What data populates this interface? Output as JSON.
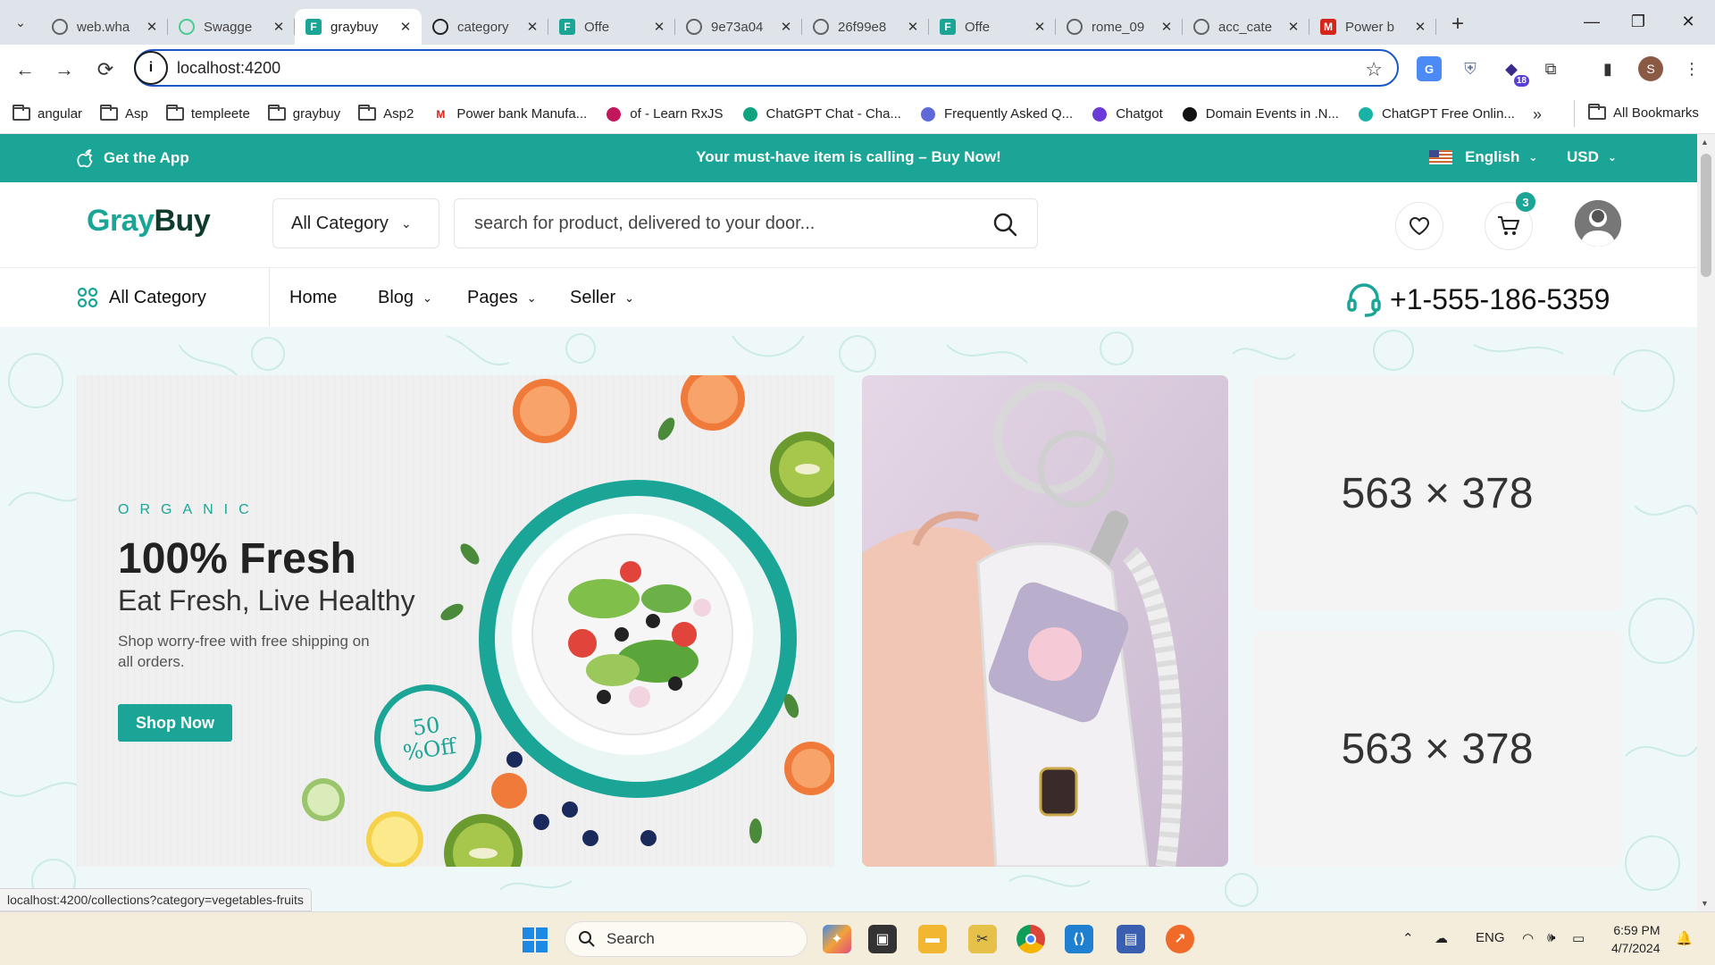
{
  "browser": {
    "tabs": [
      {
        "title": "web.wha",
        "favicon": "globe-icon",
        "color": "#5f6368"
      },
      {
        "title": "Swagge",
        "favicon": "swagger-icon",
        "color": "#49cc90"
      },
      {
        "title": "graybuy",
        "favicon": "F",
        "color": "#1aa596",
        "active": true
      },
      {
        "title": "category",
        "favicon": "angular-icon",
        "color": "#222222"
      },
      {
        "title": "Offe",
        "favicon": "F",
        "color": "#1aa596"
      },
      {
        "title": "9e73a04",
        "favicon": "globe-icon",
        "color": "#5f6368"
      },
      {
        "title": "26f99e8",
        "favicon": "globe-icon",
        "color": "#5f6368"
      },
      {
        "title": "Offe",
        "favicon": "F",
        "color": "#1aa596"
      },
      {
        "title": "rome_09",
        "favicon": "globe-icon",
        "color": "#5f6368"
      },
      {
        "title": "acc_cate",
        "favicon": "globe-icon",
        "color": "#5f6368"
      },
      {
        "title": "Power b",
        "favicon": "M",
        "color": "#d4261c"
      }
    ],
    "url": "localhost:4200",
    "profile_initial": "S",
    "extension_badge": "18",
    "bookmarks": [
      {
        "label": "angular",
        "icon": "folder-icon"
      },
      {
        "label": "Asp",
        "icon": "folder-icon"
      },
      {
        "label": "templeete",
        "icon": "folder-icon"
      },
      {
        "label": "graybuy",
        "icon": "folder-icon"
      },
      {
        "label": "Asp2",
        "icon": "folder-icon"
      },
      {
        "label": "Power bank Manufa...",
        "icon": "M"
      },
      {
        "label": "of - Learn RxJS",
        "icon": "rxjs-icon"
      },
      {
        "label": "ChatGPT Chat - Cha...",
        "icon": "chatgpt-icon"
      },
      {
        "label": "Frequently Asked Q...",
        "icon": "a-icon"
      },
      {
        "label": "Chatgot",
        "icon": "chatgot-icon"
      },
      {
        "label": "Domain Events in .N...",
        "icon": "medium-icon"
      },
      {
        "label": "ChatGPT Free Onlin...",
        "icon": "chat-icon"
      }
    ],
    "all_bookmarks": "All Bookmarks",
    "status_url": "localhost:4200/collections?category=vegetables-fruits"
  },
  "topbar": {
    "get_app": "Get the App",
    "promo_text": "Your must-have item is calling – ",
    "promo_cta": "Buy Now!",
    "language": "English",
    "currency": "USD"
  },
  "header": {
    "logo_part1": "Gray",
    "logo_part2": "Buy",
    "category_select": "All Category",
    "search_placeholder": "search for product, delivered to your door...",
    "cart_count": "3"
  },
  "menu": {
    "all_category": "All Category",
    "items": [
      {
        "label": "Home",
        "dropdown": false
      },
      {
        "label": "Blog",
        "dropdown": true
      },
      {
        "label": "Pages",
        "dropdown": true
      },
      {
        "label": "Seller",
        "dropdown": true
      }
    ],
    "phone": "+1-555-186-5359"
  },
  "hero": {
    "eyebrow": "ORGANIC",
    "title": "100% Fresh",
    "subtitle": "Eat Fresh, Live Healthy",
    "description": "Shop worry-free with free shipping on all orders.",
    "cta": "Shop Now",
    "discount_line1": "50",
    "discount_line2": "%Off",
    "placeholder_1": "563 × 378",
    "placeholder_2": "563 × 378"
  },
  "taskbar": {
    "search": "Search",
    "lang": "ENG",
    "time": "6:59 PM",
    "date": "4/7/2024"
  },
  "colors": {
    "brand": "#1aa596",
    "brand_dark": "#0f3b2e"
  }
}
